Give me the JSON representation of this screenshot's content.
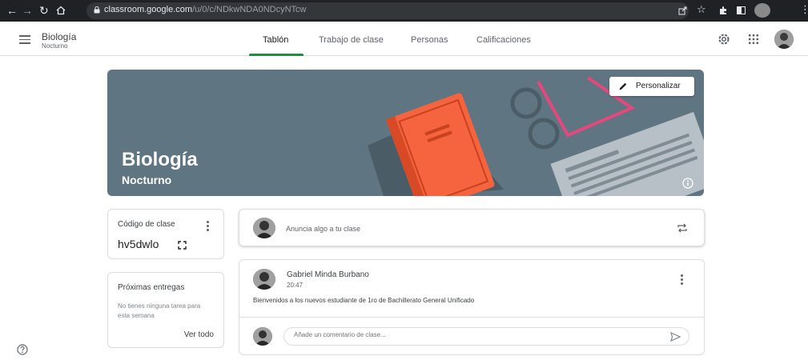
{
  "browser": {
    "url_host": "classroom.google.com",
    "url_path": "/u/0/c/NDkwNDA0NDcyNTcw"
  },
  "header": {
    "class_name": "Biología",
    "class_section": "Nocturno",
    "tabs": [
      {
        "label": "Tablón"
      },
      {
        "label": "Trabajo de clase"
      },
      {
        "label": "Personas"
      },
      {
        "label": "Calificaciones"
      }
    ]
  },
  "banner": {
    "title": "Biología",
    "subtitle": "Nocturno",
    "customize_label": "Personalizar"
  },
  "class_code": {
    "label": "Código de clase",
    "value": "hv5dwlo"
  },
  "upcoming": {
    "title": "Próximas entregas",
    "empty_text": "No tienes ninguna tarea para esta semana",
    "view_all": "Ver todo"
  },
  "announce": {
    "placeholder": "Anuncia algo a tu clase"
  },
  "post": {
    "author": "Gabriel Minda Burbano",
    "time": "20:47",
    "body": "Bienvenidos a los nuevos estudiante de 1ro de Bachillerato General Unificado",
    "comment_placeholder": "Añade un comentario de clase..."
  },
  "colors": {
    "accent_green": "#1e8e3e",
    "banner_bg": "#5f7581",
    "book_orange": "#f5643e"
  }
}
